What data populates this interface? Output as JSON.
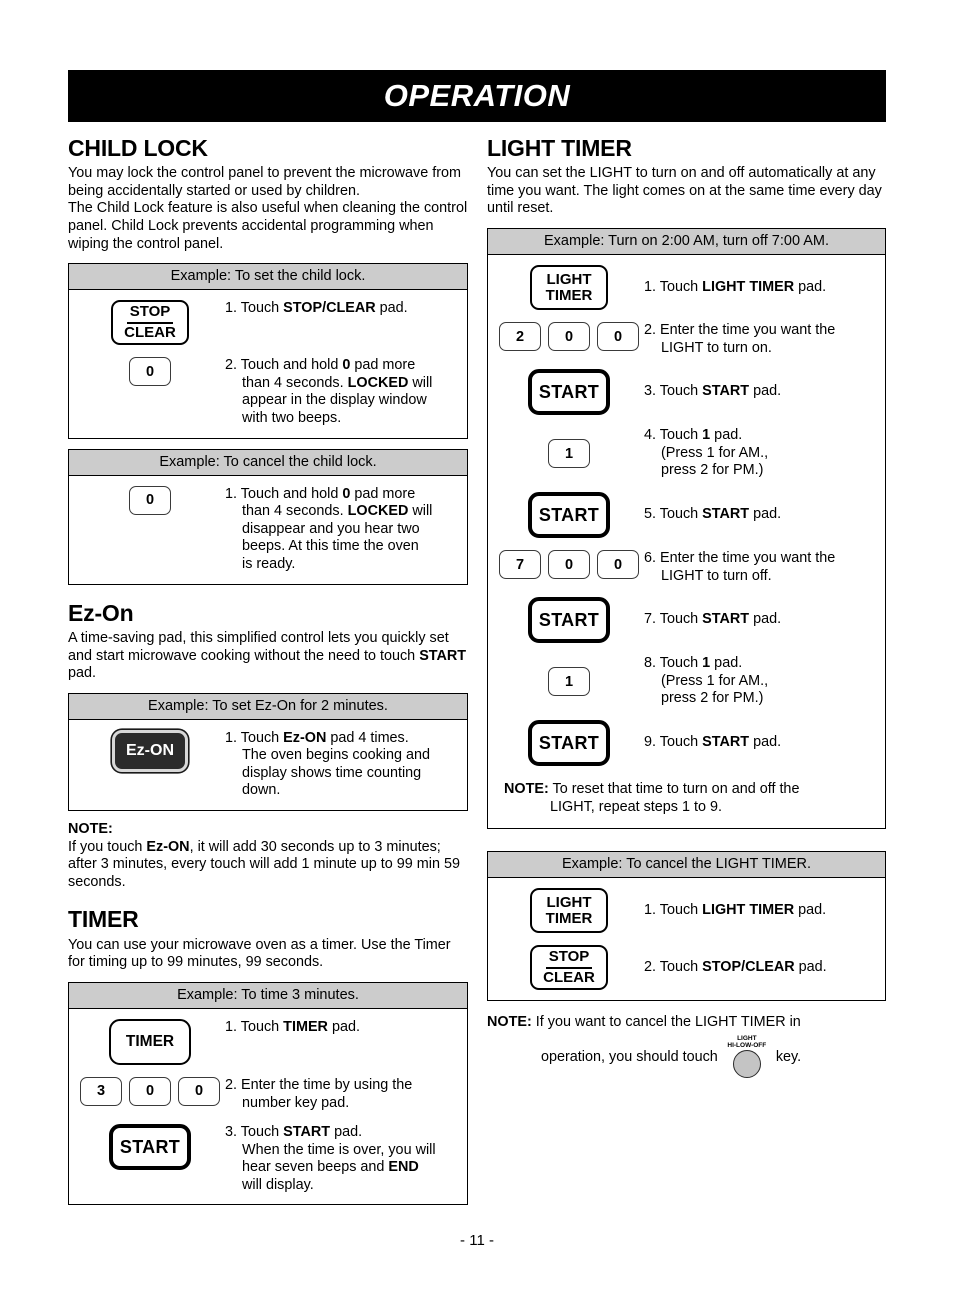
{
  "header": {
    "title": "OPERATION"
  },
  "footer": {
    "page_number": "- 11 -"
  },
  "left_column": {
    "child_lock": {
      "heading": "CHILD LOCK",
      "paragraph_1": "You may lock the control panel to prevent the microwave from being accidentally started or used by children.",
      "paragraph_2": "The Child Lock feature is also useful when cleaning the control panel. Child Lock prevents accidental programming when wiping the control panel.",
      "example_set": {
        "caption": "Example: To set the child lock.",
        "steps": [
          {
            "pad_type": "stop-clear",
            "pad_line1": "STOP",
            "pad_line2": "CLEAR",
            "num": "1.",
            "text_pre": "Touch ",
            "text_bold": "STOP/CLEAR",
            "text_post": " pad."
          },
          {
            "pad_type": "number",
            "pad_label": "0",
            "num": "2.",
            "line1_pre": "Touch and hold ",
            "line1_bold": "0",
            "line1_post": " pad more",
            "line2_pre": "than 4 seconds. ",
            "line2_bold": "LOCKED",
            "line2_post": " will",
            "line3": "appear in the display window",
            "line4": "with two beeps."
          }
        ]
      },
      "example_cancel": {
        "caption": "Example: To cancel the child lock.",
        "steps": [
          {
            "pad_type": "number",
            "pad_label": "0",
            "num": "1.",
            "line1_pre": "Touch and hold ",
            "line1_bold": "0",
            "line1_post": " pad more",
            "line2_pre": "than 4 seconds. ",
            "line2_bold": "LOCKED",
            "line2_post": " will",
            "line3": "disappear and you hear two",
            "line4": "beeps. At this time the oven",
            "line5": "is ready."
          }
        ]
      }
    },
    "ez_on": {
      "heading": "Ez-On",
      "paragraph_pre": "A time-saving pad, this simplified control lets you quickly set and start microwave cooking without the need to touch ",
      "paragraph_bold": "START",
      "paragraph_post": " pad.",
      "example": {
        "caption": "Example: To set Ez-On for 2 minutes.",
        "pad_label": "Ez-ON",
        "num": "1.",
        "line1_pre": "Touch ",
        "line1_bold": "Ez-ON",
        "line1_post": " pad 4 times.",
        "line2": "The oven begins cooking and",
        "line3": "display shows time counting",
        "line4": "down."
      },
      "note": {
        "label": "NOTE:",
        "text_pre": "If you touch ",
        "text_bold": "Ez-ON",
        "text_post": ", it will add 30 seconds up to 3 minutes; after 3 minutes, every touch will add 1 minute up to 99 min 59 seconds."
      }
    },
    "timer": {
      "heading": "TIMER",
      "paragraph": "You can use your microwave oven as a timer. Use the Timer for timing up to 99 minutes, 99 seconds.",
      "example": {
        "caption": "Example: To time  3 minutes.",
        "steps": [
          {
            "pad_type": "timer",
            "pad_label": "TIMER",
            "num": "1.",
            "text_pre": "Touch ",
            "text_bold": "TIMER ",
            "text_post": " pad."
          },
          {
            "pad_type": "numbers",
            "pad_digits": [
              "3",
              "0",
              "0"
            ],
            "num": "2.",
            "line1": "Enter the time by using the",
            "line2": "number key pad."
          },
          {
            "pad_type": "start",
            "pad_label": "START",
            "num": "3.",
            "line1_pre": "Touch ",
            "line1_bold": "START",
            "line1_post": " pad.",
            "line2": "When the time is over, you will",
            "line3_pre": "hear seven beeps and ",
            "line3_bold": "END",
            "line4": "will display."
          }
        ]
      }
    }
  },
  "right_column": {
    "light_timer": {
      "heading": "LIGHT TIMER",
      "paragraph": "You can set the LIGHT to turn on and off automatically at any time you want. The light comes on at the same time every day until reset.",
      "example_set": {
        "caption": "Example: Turn on 2:00 AM, turn off 7:00 AM.",
        "steps": [
          {
            "pad_type": "light-timer",
            "pad_line1": "LIGHT",
            "pad_line2": "TIMER",
            "num": "1.",
            "text_pre": "Touch ",
            "text_bold": "LIGHT TIMER",
            "text_post": " pad."
          },
          {
            "pad_type": "numbers",
            "pad_digits": [
              "2",
              "0",
              "0"
            ],
            "num": "2.",
            "line1": "Enter the time you want the",
            "line2": "LIGHT to turn on."
          },
          {
            "pad_type": "start",
            "pad_label": "START",
            "num": "3.",
            "text_pre": "Touch ",
            "text_bold": "START",
            "text_post": " pad."
          },
          {
            "pad_type": "number",
            "pad_label": "1",
            "num": "4.",
            "line1_pre": "Touch ",
            "line1_bold": "1",
            "line1_post": " pad.",
            "line2": "(Press 1 for AM.,",
            "line3": "press 2 for PM.)"
          },
          {
            "pad_type": "start",
            "pad_label": "START",
            "num": "5.",
            "text_pre": "Touch ",
            "text_bold": "START",
            "text_post": " pad."
          },
          {
            "pad_type": "numbers",
            "pad_digits": [
              "7",
              "0",
              "0"
            ],
            "num": "6.",
            "line1": "Enter the time you want the",
            "line2": "LIGHT to turn off."
          },
          {
            "pad_type": "start",
            "pad_label": "START",
            "num": "7.",
            "text_pre": "Touch ",
            "text_bold": "START",
            "text_post": " pad."
          },
          {
            "pad_type": "number",
            "pad_label": "1",
            "num": "8.",
            "line1_pre": "Touch ",
            "line1_bold": "1",
            "line1_post": " pad.",
            "line2": "(Press 1 for AM.,",
            "line3": "press 2 for PM.)"
          },
          {
            "pad_type": "start",
            "pad_label": "START",
            "num": "9.",
            "text_pre": "Touch ",
            "text_bold": "START",
            "text_post": " pad."
          }
        ],
        "note": {
          "label": "NOTE:",
          "line1": " To reset that time to turn on and off the",
          "line2": "LIGHT, repeat steps 1 to 9."
        }
      },
      "example_cancel": {
        "caption": "Example: To cancel the LIGHT TIMER.",
        "steps": [
          {
            "pad_type": "light-timer",
            "pad_line1": "LIGHT",
            "pad_line2": "TIMER",
            "num": "1.",
            "text_pre": "Touch ",
            "text_bold": "LIGHT TIMER",
            "text_post": " pad."
          },
          {
            "pad_type": "stop-clear",
            "pad_line1": "STOP",
            "pad_line2": "CLEAR",
            "num": "2.",
            "text_pre": "Touch ",
            "text_bold": "STOP/CLEAR",
            "text_post": " pad."
          }
        ]
      },
      "final_note": {
        "label": "NOTE:",
        "line1": " If you want to cancel the LIGHT TIMER in",
        "line2_pre": "operation, you should touch",
        "knob_label_top": "LIGHT",
        "knob_label_bottom": "HI-LOW-OFF",
        "line2_post": "key."
      }
    }
  }
}
